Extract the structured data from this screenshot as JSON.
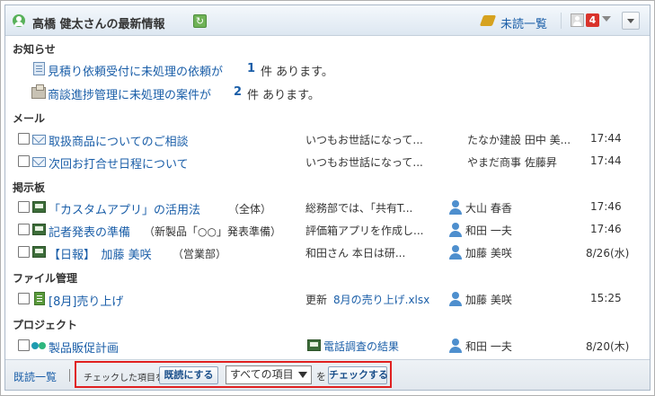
{
  "header": {
    "title": "高橋 健太さんの最新情報",
    "unread_link": "未読一覧",
    "notification_count": "4"
  },
  "notice": {
    "title": "お知らせ",
    "items": [
      {
        "prefix": "見積り依頼受付に未処理の依頼が",
        "count": "1",
        "suffix": "件 あります。"
      },
      {
        "prefix": "商談進捗管理に未処理の案件が",
        "count": "2",
        "suffix": "件 あります。"
      }
    ]
  },
  "mail": {
    "title": "メール",
    "rows": [
      {
        "subject": "取扱商品についてのご相談",
        "preview": "いつもお世話になって...",
        "sender": "たなか建設 田中 美...",
        "time": "17:44"
      },
      {
        "subject": "次回お打合せ日程について",
        "preview": "いつもお世話になって...",
        "sender": "やまだ商事 佐藤昇",
        "time": "17:44"
      }
    ]
  },
  "board": {
    "title": "掲示板",
    "rows": [
      {
        "subject": "「カスタムアプリ」の活用法",
        "category": "（全体）",
        "preview": "総務部では、「共有T...",
        "author": "大山 春香",
        "time": "17:46"
      },
      {
        "subject": "記者発表の準備",
        "category": "（新製品「○○」発表準備）",
        "preview": "評価箱アプリを作成し...",
        "author": "和田 一夫",
        "time": "17:46"
      },
      {
        "subject": "【日報】　加藤 美咲",
        "category": "（営業部）",
        "preview": "和田さん 本日は研...",
        "author": "加藤 美咲",
        "time": "8/26(水)"
      }
    ]
  },
  "files": {
    "title": "ファイル管理",
    "rows": [
      {
        "subject": "[8月]売り上げ",
        "update_prefix": "更新",
        "file_name": "8月の売り上げ.xlsx",
        "author": "加藤 美咲",
        "time": "15:25"
      }
    ]
  },
  "project": {
    "title": "プロジェクト",
    "rows": [
      {
        "subject": "製品販促計画",
        "task": "電話調査の結果",
        "author": "和田 一夫",
        "time": "8/20(木)"
      }
    ]
  },
  "footer": {
    "read_list": "既読一覧",
    "checked_label": "チェックした項目を",
    "mark_read_button": "既読にする",
    "select_value": "すべての項目",
    "wo_label": "を",
    "check_button": "チェックする"
  }
}
